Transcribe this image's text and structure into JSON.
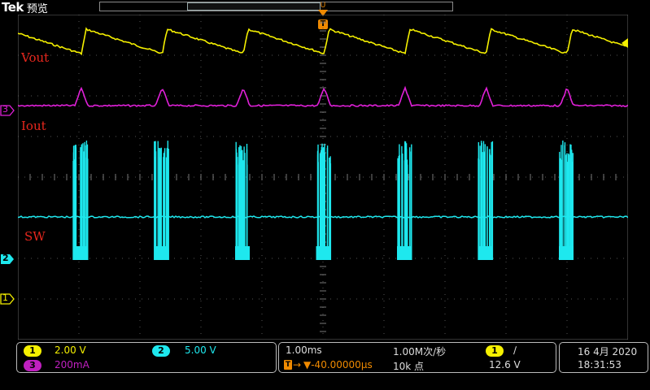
{
  "header": {
    "brand": "Tek",
    "mode": "预览"
  },
  "trigger_marker": {
    "label": "T",
    "position_label": "U"
  },
  "traces": {
    "vout": {
      "label": "Vout",
      "color": "#f5f000"
    },
    "iout": {
      "label": "Iout",
      "color": "#e020d8"
    },
    "sw": {
      "label": "SW",
      "color": "#1ee8ee"
    }
  },
  "channel_markers": {
    "ch3": {
      "num": "3",
      "color": "#e020d8"
    },
    "ch2": {
      "num": "2",
      "color": "#1ee8ee"
    },
    "ch1": {
      "num": "1",
      "color": "#f5f000"
    }
  },
  "status": {
    "ch1": {
      "num": "1",
      "scale": "2.00 V",
      "color": "#f5f000"
    },
    "ch2": {
      "num": "2",
      "scale": "5.00 V",
      "color": "#1ee8ee"
    },
    "ch3": {
      "num": "3",
      "scale": "200mA",
      "color": "#c020c0"
    },
    "timebase": "1.00ms",
    "sample_rate": "1.00M次/秒",
    "trigger_offset": "▼-40.00000µs",
    "record_length": "10k 点",
    "trigger_source": "1",
    "trigger_slope": "∕",
    "trigger_level": "12.6 V",
    "date": "16 4月 2020",
    "time": "18:31:53"
  }
}
